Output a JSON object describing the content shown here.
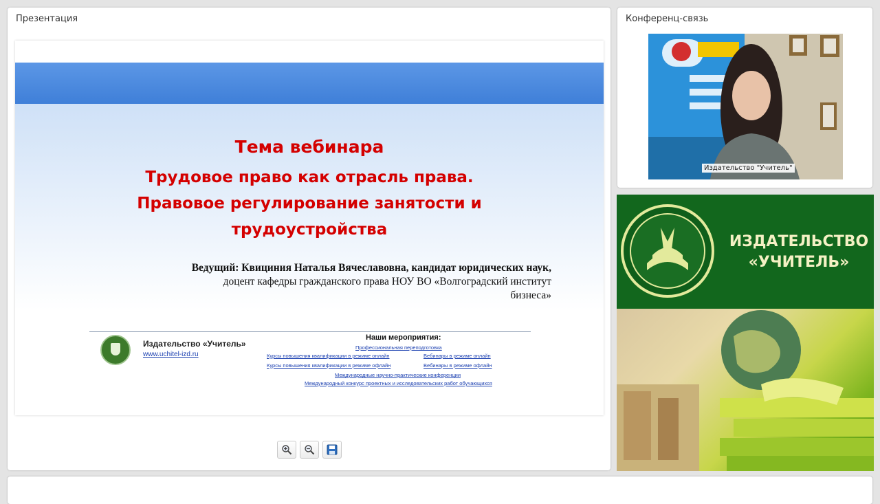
{
  "presentation_panel": {
    "title": "Презентация"
  },
  "conference_panel": {
    "title": "Конференц-связь",
    "video_caption": "Издательство \"Учитель\""
  },
  "slide": {
    "heading": "Тема вебинара",
    "topic_lines": [
      "Трудовое право как отрасль права.",
      "Правовое регулирование занятости и",
      "трудоустройства"
    ],
    "host_lines": [
      "Ведущий: Квициния Наталья Вячеславовна, кандидат юридических наук,",
      "доцент кафедры гражданского права НОУ ВО «Волгоградский институт",
      "бизнеса»"
    ],
    "footer": {
      "publisher": "Издательство «Учитель»",
      "url": "www.uchitel-izd.ru",
      "events_title": "Наши мероприятия:",
      "events": [
        "Профессиональная переподготовка",
        "Курсы повышения квалификации в режиме онлайн",
        "Вебинары в режиме онлайн",
        "Курсы повышения квалификации в режиме офлайн",
        "Вебинары в режиме офлайн",
        "Международные научно-практические конференции",
        "Международный конкурс проектных и исследовательских работ обучающихся"
      ]
    }
  },
  "toolbar": {
    "zoom_in": "zoom-in-icon",
    "zoom_out": "zoom-out-icon",
    "save": "save-icon"
  },
  "brand": {
    "line1": "ИЗДАТЕЛЬСТВО",
    "line2": "«УЧИТЕЛЬ»"
  },
  "colors": {
    "accent_red": "#d40000",
    "brand_green": "#12671d",
    "link_blue": "#1a3fb0"
  }
}
